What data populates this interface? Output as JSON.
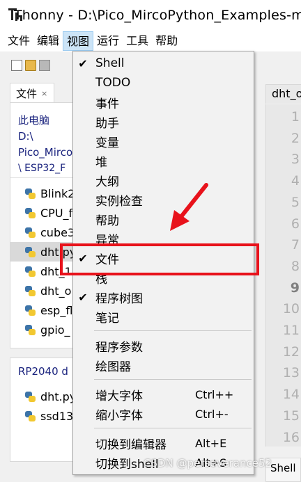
{
  "window": {
    "title": "Thonny  -  D:\\Pico_MircoPython_Examples-ma"
  },
  "menubar": [
    "文件",
    "编辑",
    "视图",
    "运行",
    "工具",
    "帮助"
  ],
  "files": {
    "tab_label": "文件",
    "close_glyph": "×",
    "path": [
      "此电脑",
      "D:\\",
      "Pico_Mirco",
      "\\ ESP32_F"
    ],
    "items": [
      {
        "name": "Blink2"
      },
      {
        "name": "CPU_f"
      },
      {
        "name": "cube3"
      },
      {
        "name": "dht.py",
        "selected": true
      },
      {
        "name": "dht_1"
      },
      {
        "name": "dht_o"
      },
      {
        "name": "esp_fl"
      },
      {
        "name": "gpio_"
      }
    ]
  },
  "rp2040": {
    "title": "RP2040 d",
    "items": [
      "dht.py",
      "ssd13"
    ]
  },
  "editor": {
    "tab_label": "dht_o",
    "line_numbers": [
      "1",
      "2",
      "3",
      "4",
      "5",
      "6",
      "7",
      "8",
      "9",
      "10",
      "11",
      "12",
      "13",
      "14",
      "15",
      "16"
    ],
    "current_line": "9"
  },
  "shell_tab": {
    "label": "Shell"
  },
  "view_menu": {
    "groups": [
      [
        {
          "label": "Shell",
          "checked": true
        },
        {
          "label": "TODO",
          "checked": false
        },
        {
          "label": "事件",
          "checked": false
        },
        {
          "label": "助手",
          "checked": false
        },
        {
          "label": "变量",
          "checked": false
        },
        {
          "label": "堆",
          "checked": false
        },
        {
          "label": "大纲",
          "checked": false
        },
        {
          "label": "实例检查",
          "checked": false
        },
        {
          "label": "帮助",
          "checked": false
        },
        {
          "label": "异常",
          "checked": false
        },
        {
          "label": "文件",
          "checked": true
        },
        {
          "label": "栈",
          "checked": false
        },
        {
          "label": "程序树图",
          "checked": true
        },
        {
          "label": "笔记",
          "checked": false
        }
      ],
      [
        {
          "label": "程序参数"
        },
        {
          "label": "绘图器"
        }
      ],
      [
        {
          "label": "增大字体",
          "shortcut": "Ctrl++"
        },
        {
          "label": "缩小字体",
          "shortcut": "Ctrl+-"
        }
      ],
      [
        {
          "label": "切换到编辑器",
          "shortcut": "Alt+E"
        },
        {
          "label": "切换到shell",
          "shortcut": "Alt+S"
        }
      ]
    ],
    "check_glyph": "✔"
  },
  "watermark": "CSDN @perseverance52",
  "colors": {
    "annotation_red": "#e8121b",
    "menu_highlight": "#cce4f7",
    "path_text": "#1a237e"
  }
}
